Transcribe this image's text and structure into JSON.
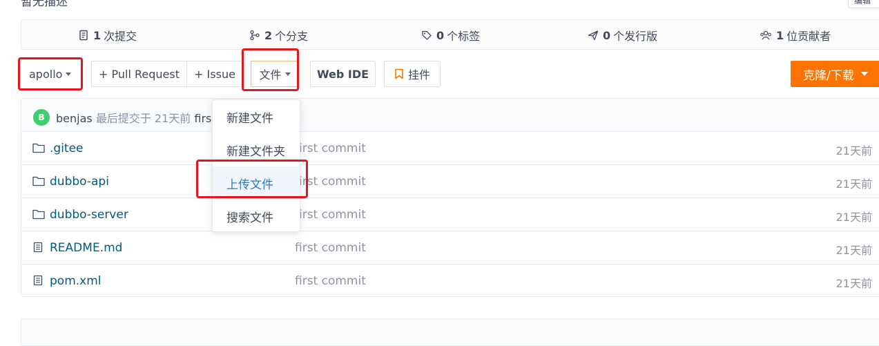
{
  "header": {
    "cut_title": "暂无描述",
    "edit_label": "编辑"
  },
  "stats": [
    {
      "icon": "commit-icon",
      "count": "1",
      "label": "次提交"
    },
    {
      "icon": "branch-icon",
      "count": "2",
      "label": "个分支"
    },
    {
      "icon": "tag-icon",
      "count": "0",
      "label": "个标签"
    },
    {
      "icon": "release-icon",
      "count": "0",
      "label": "个发行版"
    },
    {
      "icon": "contributors-icon",
      "count": "1",
      "label": "位贡献者"
    }
  ],
  "toolbar": {
    "branch": "apollo",
    "pull_request": "+ Pull Request",
    "issue": "+ Issue",
    "file_menu": "文件",
    "web_ide": "Web IDE",
    "widget": "挂件",
    "clone": "克隆/下载"
  },
  "commit": {
    "avatar_initial": "B",
    "author": "benjas",
    "meta": "最后提交于 21天前",
    "message_cut": "firs"
  },
  "files": [
    {
      "icon": "folder-icon",
      "name": ".gitee",
      "message": "first commit",
      "time": "21天前"
    },
    {
      "icon": "folder-icon",
      "name": "dubbo-api",
      "message": "first commit",
      "time": "21天前"
    },
    {
      "icon": "folder-icon",
      "name": "dubbo-server",
      "message": "first commit",
      "time": "21天前"
    },
    {
      "icon": "file-icon",
      "name": "README.md",
      "message": "first commit",
      "time": "21天前"
    },
    {
      "icon": "file-icon",
      "name": "pom.xml",
      "message": "first commit",
      "time": "21天前"
    }
  ],
  "file_dropdown": {
    "items": [
      "新建文件",
      "新建文件夹",
      "上传文件",
      "搜索文件"
    ],
    "highlighted_index": 2
  },
  "colors": {
    "accent": "#fe7300",
    "annotation": "#e8141b",
    "link": "#005980",
    "highlight": "#2e79c4"
  }
}
